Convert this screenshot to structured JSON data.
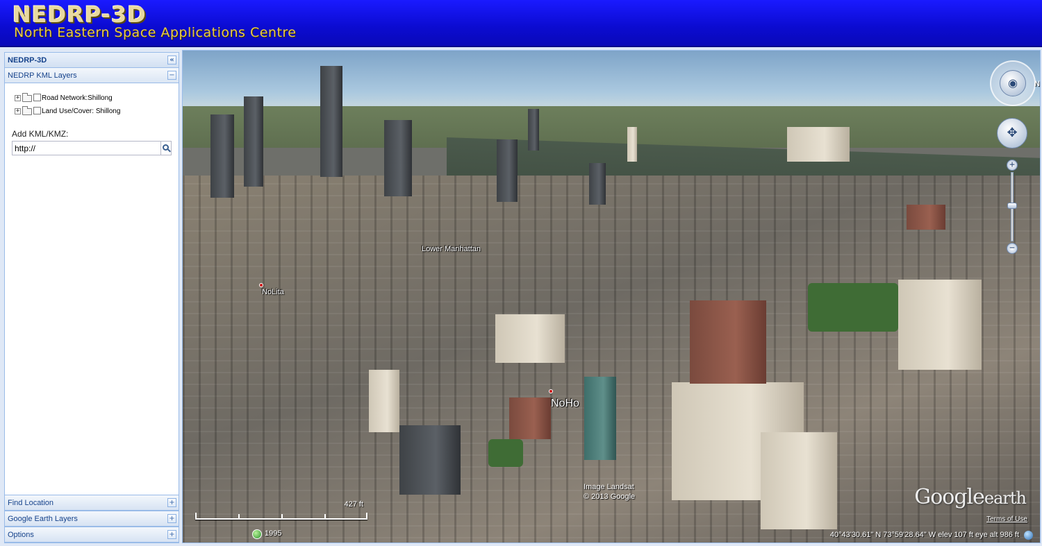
{
  "header": {
    "title": "NEDRP-3D",
    "subtitle": "North Eastern Space Applications Centre"
  },
  "sidebar": {
    "title": "NEDRP-3D",
    "collapse_symbol": "«",
    "kml_panel": {
      "title": "NEDRP KML Layers",
      "toggle_symbol": "−",
      "layers": [
        {
          "label": "Road Network:Shillong",
          "checked": false
        },
        {
          "label": "Land Use/Cover: Shillong",
          "checked": false
        }
      ],
      "add_label": "Add KML/KMZ:",
      "url_value": "http://"
    },
    "bottom_panels": [
      {
        "label": "Find Location",
        "toggle_symbol": "+"
      },
      {
        "label": "Google Earth Layers",
        "toggle_symbol": "+"
      },
      {
        "label": "Options",
        "toggle_symbol": "+"
      }
    ]
  },
  "viewer": {
    "places": {
      "lower_manhattan": "Lower Manhattan",
      "nolita": "NoLita",
      "noho": "NoHo"
    },
    "north_label": "N",
    "attribution_line1": "Image Landsat",
    "attribution_line2": "© 2013 Google",
    "logo_google": "Google",
    "logo_earth": "earth",
    "terms": "Terms of Use",
    "scale": "427 ft",
    "year": "1995",
    "status": "40°43'30.61\" N   73°59'28.64\" W  elev   107 ft      eye alt    986 ft"
  }
}
